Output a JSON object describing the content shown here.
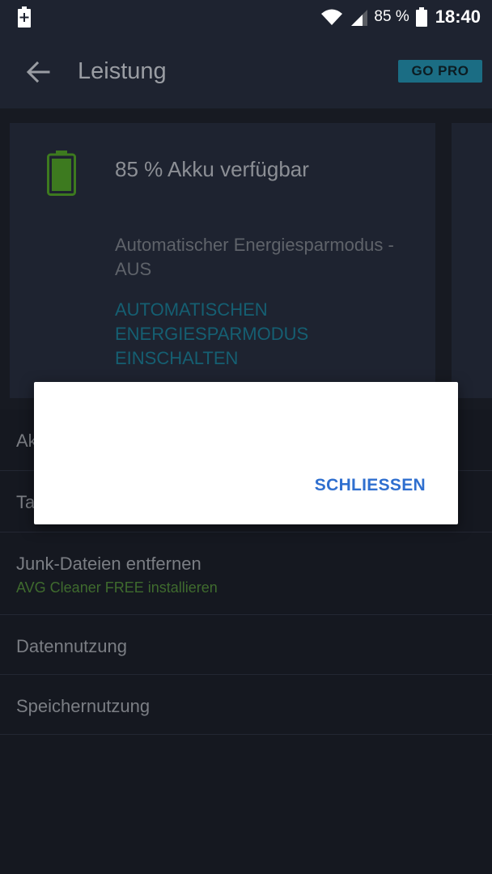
{
  "status_bar": {
    "battery_percent": "85 %",
    "time": "18:40"
  },
  "app_bar": {
    "title": "Leistung",
    "go_pro_label": "GO PRO"
  },
  "battery_card": {
    "title": "85 % Akku verfügbar",
    "mode_status": "Automatischer Energiesparmodus - AUS",
    "mode_action": "AUTOMATISCHEN ENERGIESPARMODUS EINSCHALTEN"
  },
  "list": {
    "items": [
      {
        "title": "Ak"
      },
      {
        "title": "Ta"
      },
      {
        "title": "Junk-Dateien entfernen",
        "subtitle": "AVG Cleaner FREE installieren"
      },
      {
        "title": "Datennutzung"
      },
      {
        "title": "Speichernutzung"
      }
    ]
  },
  "dialog": {
    "close_label": "SCHLIESSEN"
  },
  "colors": {
    "background": "#1e2330",
    "accent": "#2f6fcf",
    "go_pro": "#1b6d84",
    "battery_green": "#4caf2f",
    "link_teal": "#155f72",
    "subtitle_green": "#3f6b2e"
  },
  "icons": {
    "status_charging": "battery-charging-icon",
    "wifi": "wifi-icon",
    "signal": "signal-icon",
    "battery": "battery-icon",
    "back": "back-arrow-icon"
  }
}
